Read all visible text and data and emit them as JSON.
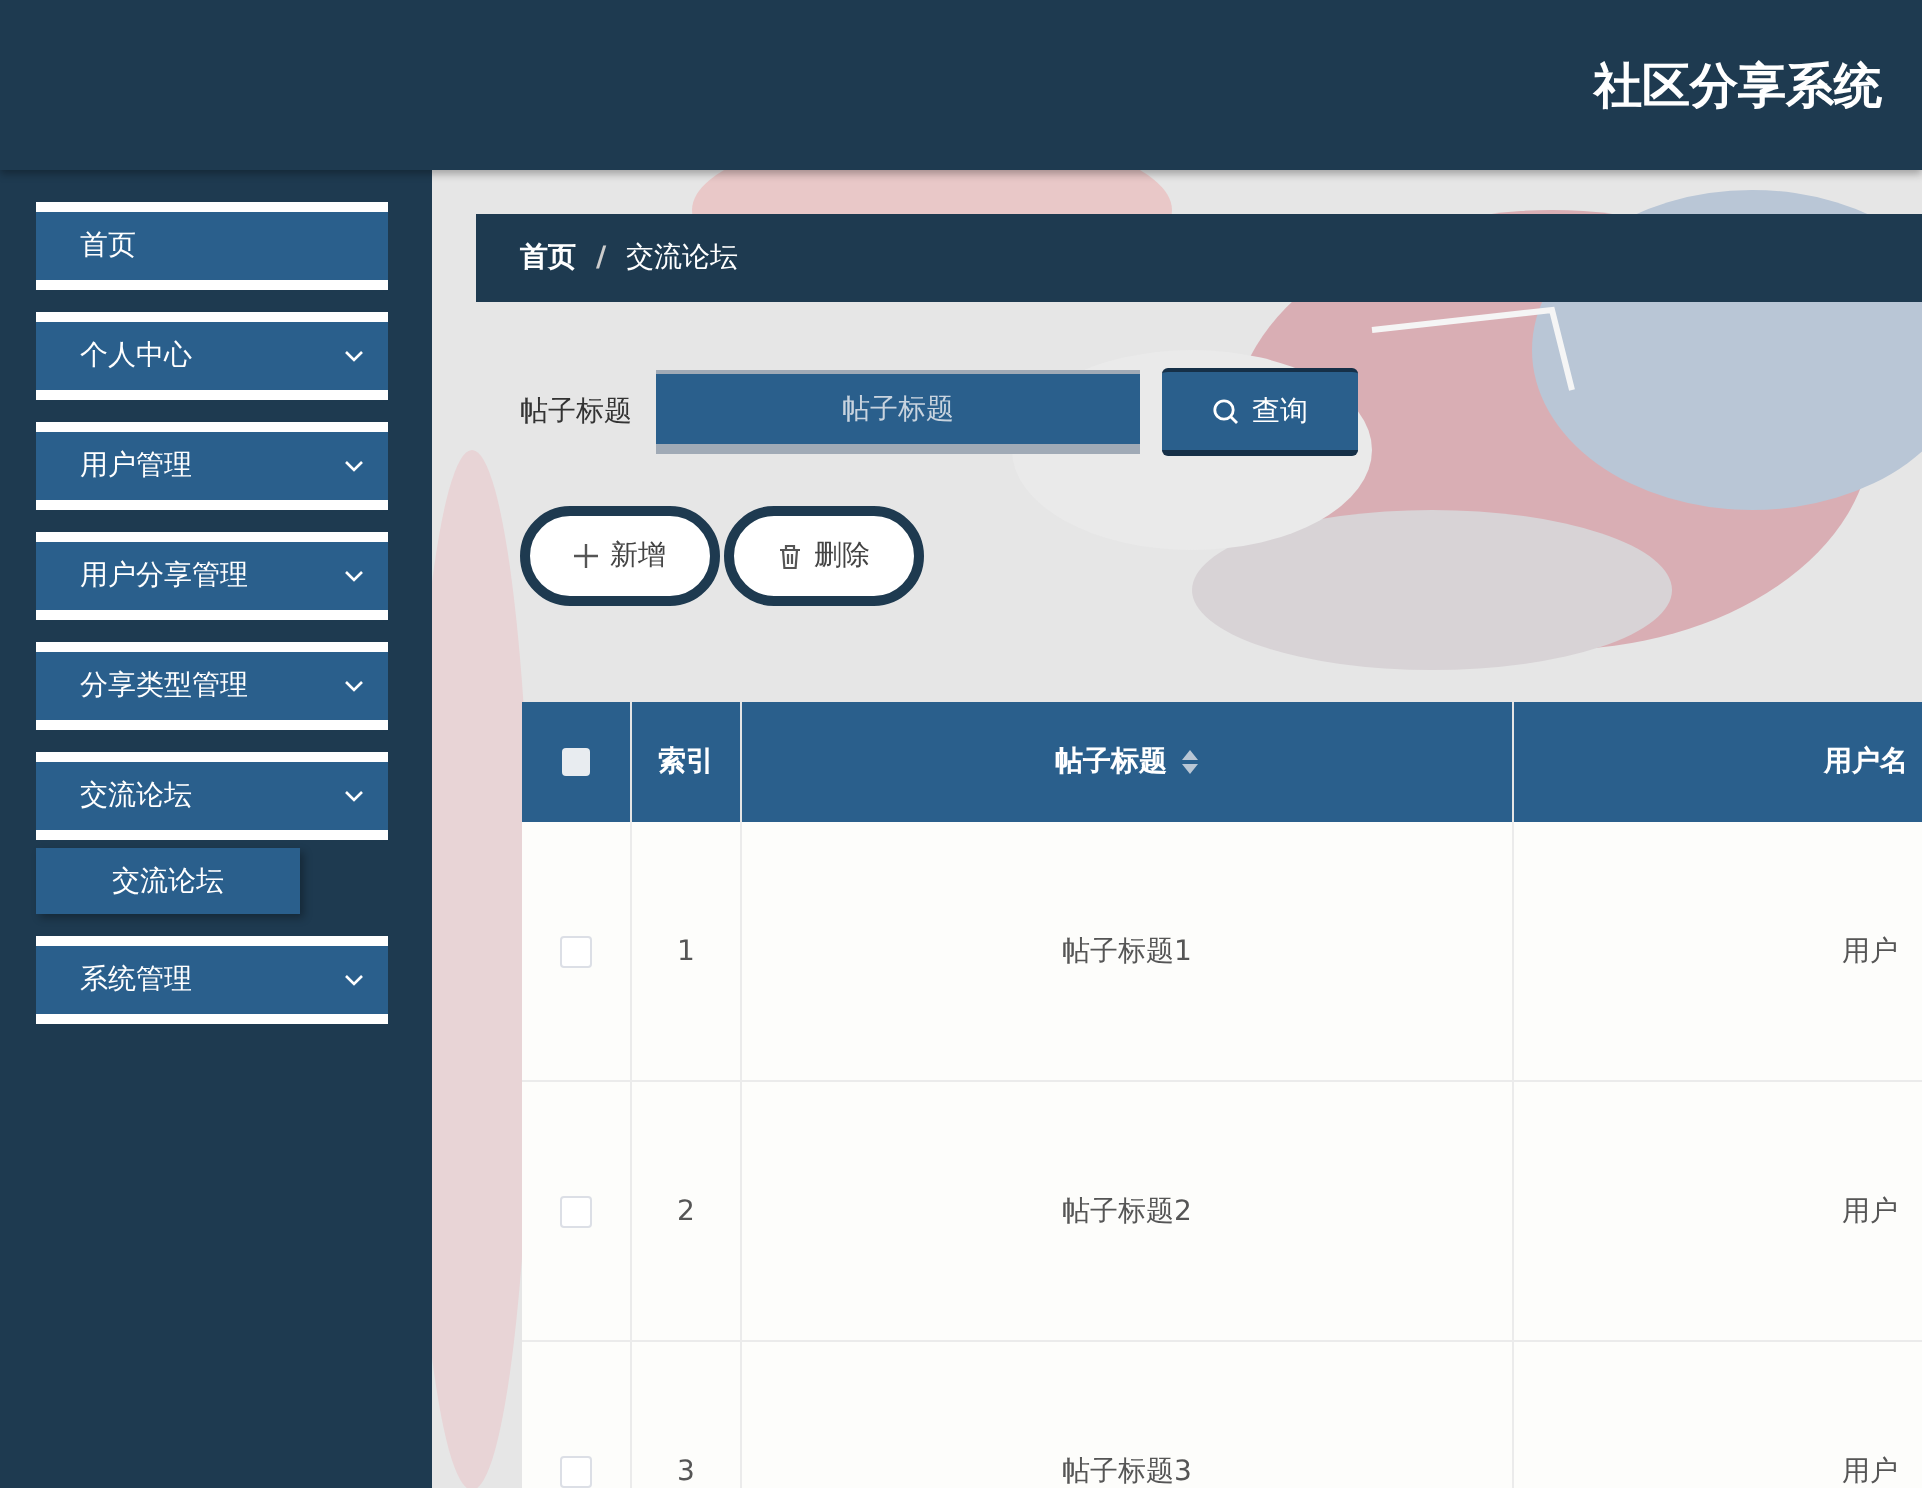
{
  "header": {
    "title": "社区分享系统"
  },
  "sidebar": {
    "items": [
      {
        "label": "首页",
        "expandable": false
      },
      {
        "label": "个人中心",
        "expandable": true
      },
      {
        "label": "用户管理",
        "expandable": true
      },
      {
        "label": "用户分享管理",
        "expandable": true
      },
      {
        "label": "分享类型管理",
        "expandable": true
      },
      {
        "label": "交流论坛",
        "expandable": true,
        "children": [
          {
            "label": "交流论坛"
          }
        ]
      },
      {
        "label": "系统管理",
        "expandable": true
      }
    ]
  },
  "breadcrumb": {
    "items": [
      "首页",
      "交流论坛"
    ],
    "separator": "/"
  },
  "search": {
    "label": "帖子标题",
    "placeholder": "帖子标题",
    "button": "查询"
  },
  "actions": [
    {
      "kind": "add",
      "label": "新增"
    },
    {
      "kind": "delete",
      "label": "删除"
    }
  ],
  "table": {
    "header_checked": false,
    "columns": [
      {
        "kind": "index",
        "label": "索引",
        "sortable": false
      },
      {
        "kind": "title",
        "label": "帖子标题",
        "sortable": true
      },
      {
        "kind": "user",
        "label": "用户名"
      }
    ],
    "rows": [
      {
        "checked": false,
        "cells": [
          "1",
          "帖子标题1",
          "用户"
        ]
      },
      {
        "checked": false,
        "cells": [
          "2",
          "帖子标题2",
          "用户"
        ]
      },
      {
        "checked": false,
        "cells": [
          "3",
          "帖子标题3",
          "用户"
        ]
      }
    ]
  }
}
